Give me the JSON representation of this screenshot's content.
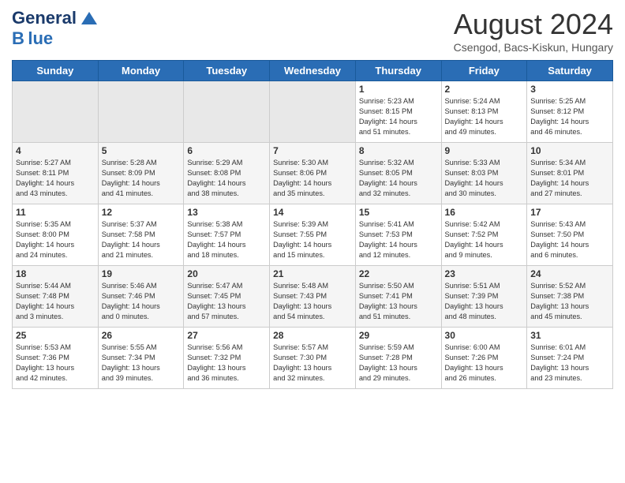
{
  "header": {
    "logo_general": "General",
    "logo_blue": "Blue",
    "title": "August 2024",
    "location": "Csengod, Bacs-Kiskun, Hungary"
  },
  "days_of_week": [
    "Sunday",
    "Monday",
    "Tuesday",
    "Wednesday",
    "Thursday",
    "Friday",
    "Saturday"
  ],
  "weeks": [
    [
      {
        "day": "",
        "info": ""
      },
      {
        "day": "",
        "info": ""
      },
      {
        "day": "",
        "info": ""
      },
      {
        "day": "",
        "info": ""
      },
      {
        "day": "1",
        "info": "Sunrise: 5:23 AM\nSunset: 8:15 PM\nDaylight: 14 hours\nand 51 minutes."
      },
      {
        "day": "2",
        "info": "Sunrise: 5:24 AM\nSunset: 8:13 PM\nDaylight: 14 hours\nand 49 minutes."
      },
      {
        "day": "3",
        "info": "Sunrise: 5:25 AM\nSunset: 8:12 PM\nDaylight: 14 hours\nand 46 minutes."
      }
    ],
    [
      {
        "day": "4",
        "info": "Sunrise: 5:27 AM\nSunset: 8:11 PM\nDaylight: 14 hours\nand 43 minutes."
      },
      {
        "day": "5",
        "info": "Sunrise: 5:28 AM\nSunset: 8:09 PM\nDaylight: 14 hours\nand 41 minutes."
      },
      {
        "day": "6",
        "info": "Sunrise: 5:29 AM\nSunset: 8:08 PM\nDaylight: 14 hours\nand 38 minutes."
      },
      {
        "day": "7",
        "info": "Sunrise: 5:30 AM\nSunset: 8:06 PM\nDaylight: 14 hours\nand 35 minutes."
      },
      {
        "day": "8",
        "info": "Sunrise: 5:32 AM\nSunset: 8:05 PM\nDaylight: 14 hours\nand 32 minutes."
      },
      {
        "day": "9",
        "info": "Sunrise: 5:33 AM\nSunset: 8:03 PM\nDaylight: 14 hours\nand 30 minutes."
      },
      {
        "day": "10",
        "info": "Sunrise: 5:34 AM\nSunset: 8:01 PM\nDaylight: 14 hours\nand 27 minutes."
      }
    ],
    [
      {
        "day": "11",
        "info": "Sunrise: 5:35 AM\nSunset: 8:00 PM\nDaylight: 14 hours\nand 24 minutes."
      },
      {
        "day": "12",
        "info": "Sunrise: 5:37 AM\nSunset: 7:58 PM\nDaylight: 14 hours\nand 21 minutes."
      },
      {
        "day": "13",
        "info": "Sunrise: 5:38 AM\nSunset: 7:57 PM\nDaylight: 14 hours\nand 18 minutes."
      },
      {
        "day": "14",
        "info": "Sunrise: 5:39 AM\nSunset: 7:55 PM\nDaylight: 14 hours\nand 15 minutes."
      },
      {
        "day": "15",
        "info": "Sunrise: 5:41 AM\nSunset: 7:53 PM\nDaylight: 14 hours\nand 12 minutes."
      },
      {
        "day": "16",
        "info": "Sunrise: 5:42 AM\nSunset: 7:52 PM\nDaylight: 14 hours\nand 9 minutes."
      },
      {
        "day": "17",
        "info": "Sunrise: 5:43 AM\nSunset: 7:50 PM\nDaylight: 14 hours\nand 6 minutes."
      }
    ],
    [
      {
        "day": "18",
        "info": "Sunrise: 5:44 AM\nSunset: 7:48 PM\nDaylight: 14 hours\nand 3 minutes."
      },
      {
        "day": "19",
        "info": "Sunrise: 5:46 AM\nSunset: 7:46 PM\nDaylight: 14 hours\nand 0 minutes."
      },
      {
        "day": "20",
        "info": "Sunrise: 5:47 AM\nSunset: 7:45 PM\nDaylight: 13 hours\nand 57 minutes."
      },
      {
        "day": "21",
        "info": "Sunrise: 5:48 AM\nSunset: 7:43 PM\nDaylight: 13 hours\nand 54 minutes."
      },
      {
        "day": "22",
        "info": "Sunrise: 5:50 AM\nSunset: 7:41 PM\nDaylight: 13 hours\nand 51 minutes."
      },
      {
        "day": "23",
        "info": "Sunrise: 5:51 AM\nSunset: 7:39 PM\nDaylight: 13 hours\nand 48 minutes."
      },
      {
        "day": "24",
        "info": "Sunrise: 5:52 AM\nSunset: 7:38 PM\nDaylight: 13 hours\nand 45 minutes."
      }
    ],
    [
      {
        "day": "25",
        "info": "Sunrise: 5:53 AM\nSunset: 7:36 PM\nDaylight: 13 hours\nand 42 minutes."
      },
      {
        "day": "26",
        "info": "Sunrise: 5:55 AM\nSunset: 7:34 PM\nDaylight: 13 hours\nand 39 minutes."
      },
      {
        "day": "27",
        "info": "Sunrise: 5:56 AM\nSunset: 7:32 PM\nDaylight: 13 hours\nand 36 minutes."
      },
      {
        "day": "28",
        "info": "Sunrise: 5:57 AM\nSunset: 7:30 PM\nDaylight: 13 hours\nand 32 minutes."
      },
      {
        "day": "29",
        "info": "Sunrise: 5:59 AM\nSunset: 7:28 PM\nDaylight: 13 hours\nand 29 minutes."
      },
      {
        "day": "30",
        "info": "Sunrise: 6:00 AM\nSunset: 7:26 PM\nDaylight: 13 hours\nand 26 minutes."
      },
      {
        "day": "31",
        "info": "Sunrise: 6:01 AM\nSunset: 7:24 PM\nDaylight: 13 hours\nand 23 minutes."
      }
    ]
  ]
}
